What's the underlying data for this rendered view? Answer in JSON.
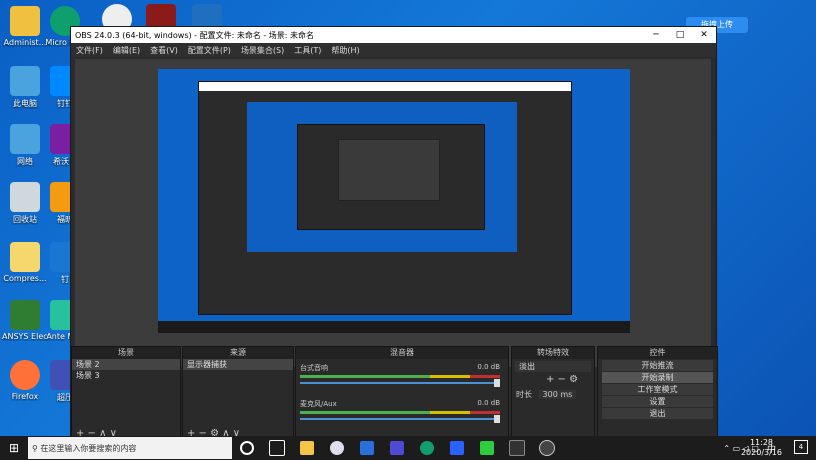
{
  "desktop": {
    "icons": [
      {
        "label": "Administ...",
        "color": "#f0c040"
      },
      {
        "label": "此电脑",
        "color": "#4aa3df"
      },
      {
        "label": "网络",
        "color": "#4aa3df"
      },
      {
        "label": "回收站",
        "color": "#cfd8dc"
      },
      {
        "label": "Compres...",
        "color": "#f5d76e"
      },
      {
        "label": "ANSYS Electroni...",
        "color": "#2e7d32"
      },
      {
        "label": "Firefox",
        "color": "#ff7139"
      }
    ],
    "icons_col2": [
      {
        "label": "Micro Edg",
        "color": "#0e9f6e"
      },
      {
        "label": "钉钉",
        "color": "#0089ff"
      },
      {
        "label": "希沃白",
        "color": "#7b1fa2"
      },
      {
        "label": "福昕",
        "color": "#f39c12"
      },
      {
        "label": "钉",
        "color": "#1976d2"
      },
      {
        "label": "Ante Mac",
        "color": "#27c1a0"
      },
      {
        "label": "超压",
        "color": "#3f51b5"
      }
    ],
    "baidu_badge": "拖拽上传"
  },
  "obs": {
    "title": "OBS 24.0.3 (64-bit, windows) - 配置文件: 未命名 - 场景: 未命名",
    "menu": [
      "文件(F)",
      "编辑(E)",
      "查看(V)",
      "配置文件(P)",
      "场景集合(S)",
      "工具(T)",
      "帮助(H)"
    ],
    "docks": {
      "scenes": {
        "title": "场景",
        "items": [
          "场景 2",
          "场景 3"
        ],
        "footer": "+ − ∧ ∨"
      },
      "sources": {
        "title": "来源",
        "items": [
          "显示器捕获"
        ],
        "footer": "+ − ⚙ ∧ ∨"
      },
      "mixer": {
        "title": "混音器",
        "channels": [
          {
            "name": "台式音响",
            "db": "0.0 dB"
          },
          {
            "name": "麦克风/Aux",
            "db": "0.0 dB"
          }
        ]
      },
      "transitions": {
        "title": "转场特效",
        "type": "淡出",
        "duration_label": "时长",
        "duration": "300 ms"
      },
      "controls": {
        "title": "控件",
        "buttons": [
          "开始推流",
          "开始录制",
          "工作室模式",
          "设置",
          "退出"
        ]
      }
    }
  },
  "taskbar": {
    "search_placeholder": "在这里输入你要搜索的内容",
    "ime": "中",
    "time": "11:28",
    "date": "2020/3/16",
    "notify_count": "4"
  },
  "colors": {
    "desktop": "#0d63c7",
    "obs_bg": "#2b2b2b",
    "accent": "#4a90d9"
  }
}
